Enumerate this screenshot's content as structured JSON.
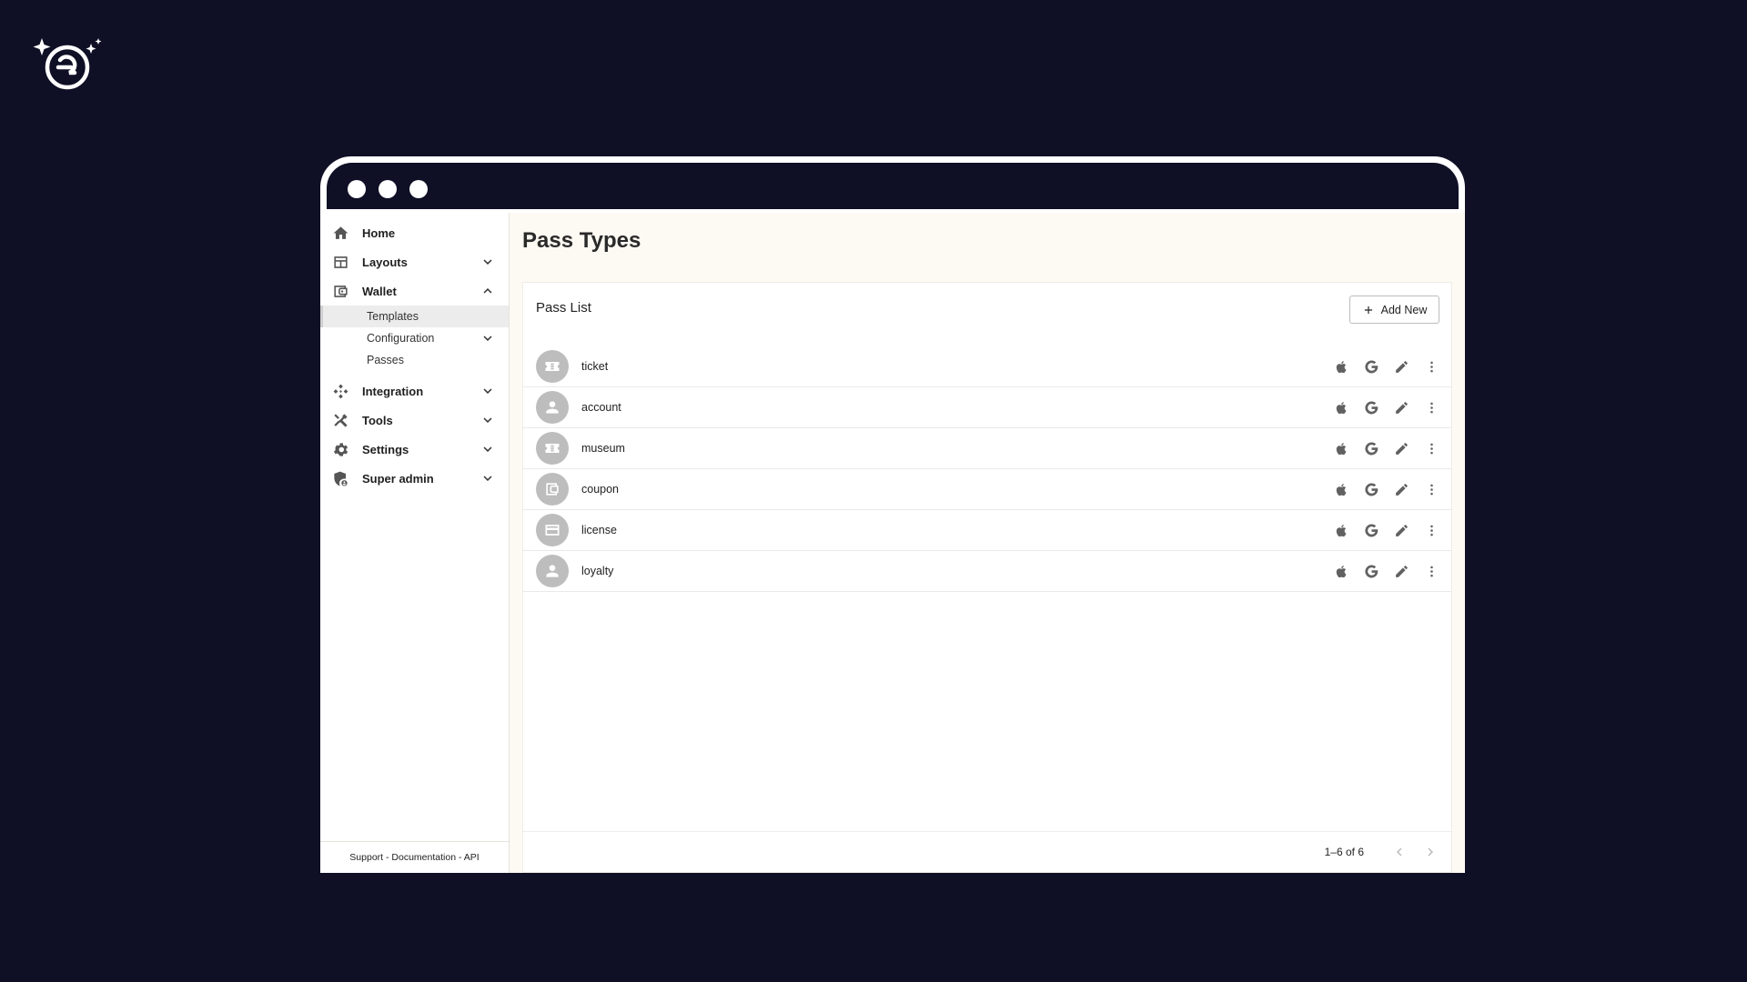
{
  "window": {
    "controls": [
      "close",
      "minimize",
      "maximize"
    ]
  },
  "sidebar": {
    "items": [
      {
        "label": "Home",
        "icon": "home-icon"
      },
      {
        "label": "Layouts",
        "icon": "layouts-icon",
        "expandable": true
      },
      {
        "label": "Wallet",
        "icon": "wallet-icon",
        "expanded": true,
        "children": [
          {
            "label": "Templates",
            "active": true
          },
          {
            "label": "Configuration",
            "expandable": true
          },
          {
            "label": "Passes"
          }
        ]
      },
      {
        "label": "Integration",
        "icon": "integration-icon",
        "expandable": true
      },
      {
        "label": "Tools",
        "icon": "tools-icon",
        "expandable": true
      },
      {
        "label": "Settings",
        "icon": "gear-icon",
        "expandable": true
      },
      {
        "label": "Super admin",
        "icon": "admin-shield-icon",
        "expandable": true
      }
    ],
    "footer": "Support - Documentation - API"
  },
  "main": {
    "title": "Pass Types",
    "card": {
      "title": "Pass List",
      "add_label": "Add New",
      "rows": [
        {
          "label": "ticket",
          "icon": "ticket-icon"
        },
        {
          "label": "account",
          "icon": "person-icon"
        },
        {
          "label": "museum",
          "icon": "ticket-icon"
        },
        {
          "label": "coupon",
          "icon": "wallet-icon"
        },
        {
          "label": "license",
          "icon": "card-icon"
        },
        {
          "label": "loyalty",
          "icon": "person-icon"
        }
      ],
      "row_actions": [
        "apple-icon",
        "google-icon",
        "edit-icon",
        "more-vert-icon"
      ],
      "pagination": {
        "text": "1–6 of 6"
      }
    }
  },
  "colors": {
    "background": "#0f0f26",
    "content": "#fdf9f3",
    "icon_gray": "#616161",
    "avatar": "#bdbdbd"
  }
}
